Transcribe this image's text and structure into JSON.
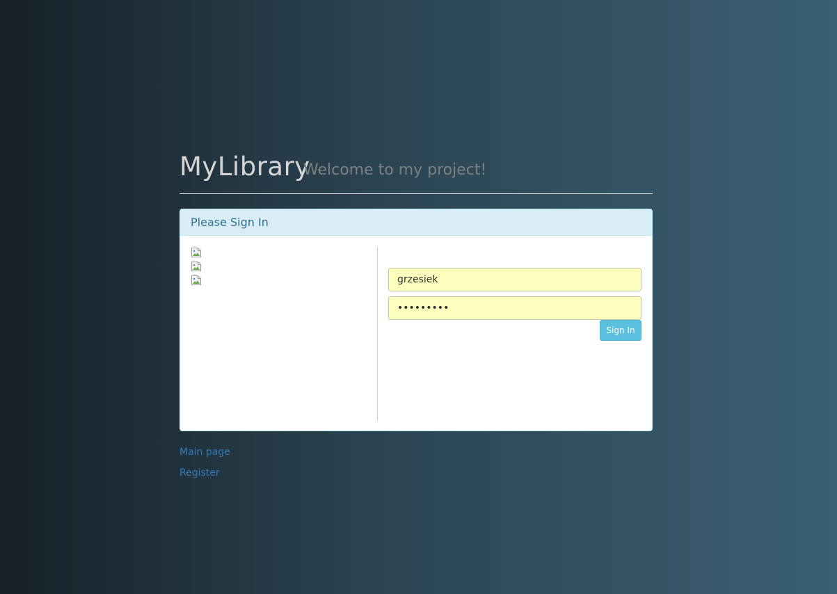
{
  "header": {
    "brand": "MyLibrary",
    "tagline": "Welcome to my project!"
  },
  "panel": {
    "title": "Please Sign In",
    "images": [
      "broken-image-icon",
      "broken-image-icon",
      "broken-image-icon"
    ],
    "username_value": "grzesiek",
    "password_value": "•••••••••",
    "signin_label": "Sign In"
  },
  "links": {
    "main_page": "Main page",
    "register": "Register"
  },
  "colors": {
    "panel_heading_bg": "#d9edf7",
    "button_info": "#5bc0de",
    "link": "#337ab7",
    "autofill_bg": "#fcfebe"
  }
}
